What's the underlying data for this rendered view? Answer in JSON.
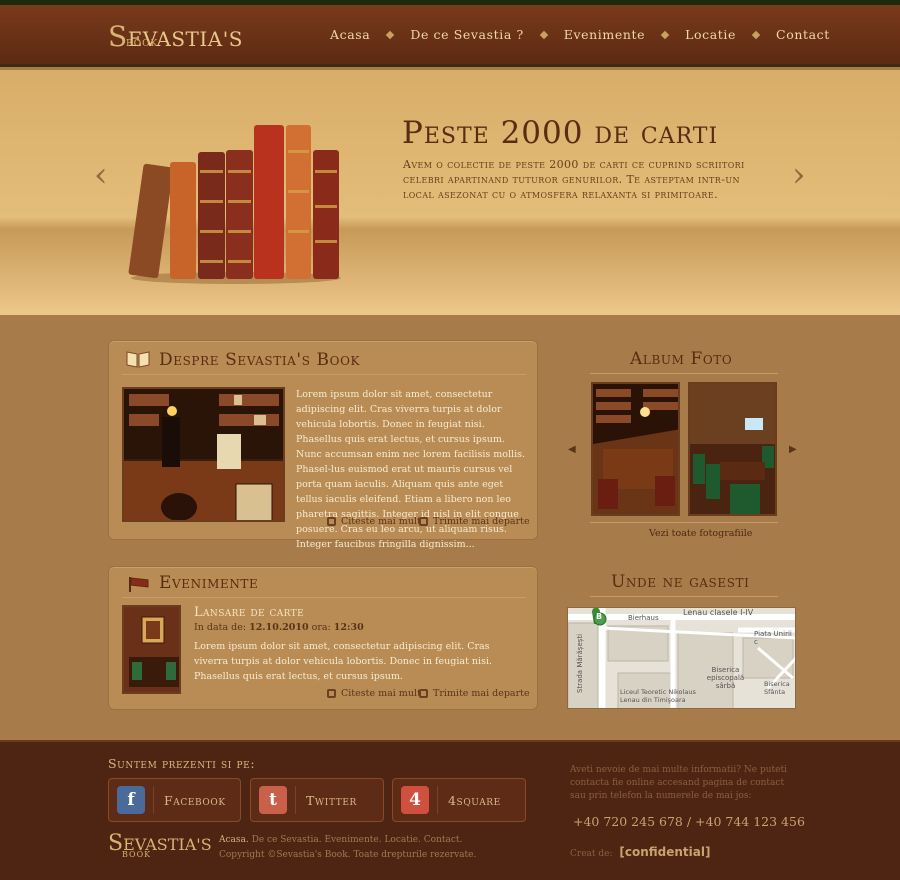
{
  "brand": {
    "name_initial": "S",
    "name_rest": "EVASTIA'S",
    "sub": "BOOK"
  },
  "nav": {
    "items": [
      "Acasa",
      "De ce Sevastia ?",
      "Evenimente",
      "Locatie",
      "Contact"
    ]
  },
  "hero": {
    "title": "Peste 2000 de carti",
    "text": "Avem o colectie de peste 2000 de carti ce cuprind scriitori celebri apartinand tuturor genurilor. Te asteptam intr-un local asezonat cu o atmosfera relaxanta si primitoare.",
    "prev_icon": "chevron-left-icon",
    "next_icon": "chevron-right-icon"
  },
  "about": {
    "title": "Despre Sevastia's Book",
    "text": "Lorem ipsum dolor sit amet, consectetur adipiscing elit. Cras viverra turpis at dolor vehicula lobortis. Donec in feugiat nisi. Phasellus quis erat lectus, et cursus ipsum. Nunc accumsan enim nec lorem facilisis mollis. Phasel-lus euismod erat ut mauris cursus vel porta quam iaculis. Aliquam quis ante eget tellus iaculis eleifend. Etiam a libero non leo pharetra sagittis. Integer id nisl in elit congue posuere. Cras eu leo arcu, ut aliquam risus. Integer faucibus fringilla dignissim...",
    "read_more": "Citeste mai mult",
    "send": "Trimite mai departe"
  },
  "events": {
    "title": "Evenimente",
    "event_title": "Lansare de carte",
    "date_label": "In data de:",
    "date_value": "12.10.2010",
    "time_label": "ora:",
    "time_value": "12:30",
    "text": "Lorem ipsum dolor sit amet, consectetur adipiscing elit. Cras viverra turpis at dolor vehicula lobortis. Donec in feugiat nisi. Phasellus quis erat lectus, et cursus ipsum.",
    "read_more": "Citeste mai mult",
    "send": "Trimite mai departe"
  },
  "album": {
    "title": "Album Foto",
    "view_all": "Vezi toate fotografiile"
  },
  "map": {
    "title": "Unde ne gasesti",
    "labels": [
      "Lenau clasele I-IV",
      "Bierhaus",
      "Piata Unirii c",
      "Strada Mărășești",
      "Biserica episcopală sârbă",
      "Liceul Teoretic Nikolaus Lenau din Timişoara",
      "Biserica Sfânta"
    ],
    "marker": "B"
  },
  "footer": {
    "present_title": "Suntem prezenti si pe:",
    "social": [
      {
        "label": "Facebook",
        "icon": "f",
        "color": "#4a6a9a"
      },
      {
        "label": "Twitter",
        "icon": "t",
        "color": "#c8604a"
      },
      {
        "label": "4square",
        "icon": "4",
        "color": "#d0503e"
      }
    ],
    "contact_text": "Aveti nevoie de mai multe informatii? Ne puteti contacta fie online accesand pagina de contact sau prin telefon la numerele de mai jos:",
    "phones": "+40 720 245 678 / +40 744 123 456",
    "links": [
      "Acasa.",
      "De ce Sevastia.",
      "Evenimente.",
      "Locatie.",
      "Contact."
    ],
    "copyright": "Copyright ©Sevastia's Book. Toate drepturile rezervate.",
    "created_label": "Creat de:",
    "created_value": "[confidential]"
  }
}
